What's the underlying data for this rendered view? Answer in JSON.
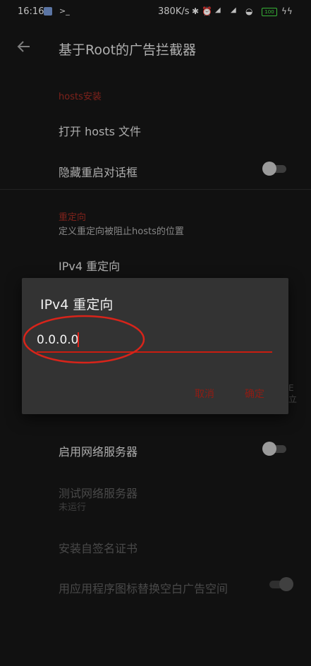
{
  "status_bar": {
    "time": "16:16",
    "net_speed": "380K/s",
    "icons": [
      "gallery-icon",
      "terminal-icon",
      "bluetooth-icon",
      "alarm-icon",
      "hd-signal-icon",
      "hd-signal-icon",
      "wifi-icon",
      "battery-icon",
      "charging-icon"
    ],
    "battery_label": "100",
    "battery_color": "#44dd44"
  },
  "app_bar": {
    "title": "基于Root的广告拦截器"
  },
  "sections": [
    {
      "header": "hosts安装",
      "items": [
        {
          "title": "打开 hosts 文件"
        },
        {
          "title": "隐藏重启对话框",
          "switch_on": false
        }
      ]
    },
    {
      "header": "重定向",
      "summary": "定义重定向被阻止hosts的位置",
      "items": [
        {
          "title": "IPv4 重定向"
        }
      ]
    },
    {
      "items": [
        {
          "title": "启用网络服务器",
          "switch_on": false
        },
        {
          "title": "测试网络服务器",
          "summary": "未运行",
          "enabled": false
        },
        {
          "title": "安装自签名证书",
          "enabled": false
        },
        {
          "title": "用应用程序图标替换空白广告空间",
          "switch_on": true,
          "enabled": false
        }
      ]
    }
  ],
  "peek_text": [
    "E",
    "立"
  ],
  "dialog": {
    "title": "IPv4 重定向",
    "input_value": "0.0.0.0",
    "cancel_label": "取消",
    "ok_label": "确定"
  },
  "colors": {
    "accent": "#c91d10",
    "dialog_bg": "#333333",
    "screen_bg": "#151515"
  }
}
